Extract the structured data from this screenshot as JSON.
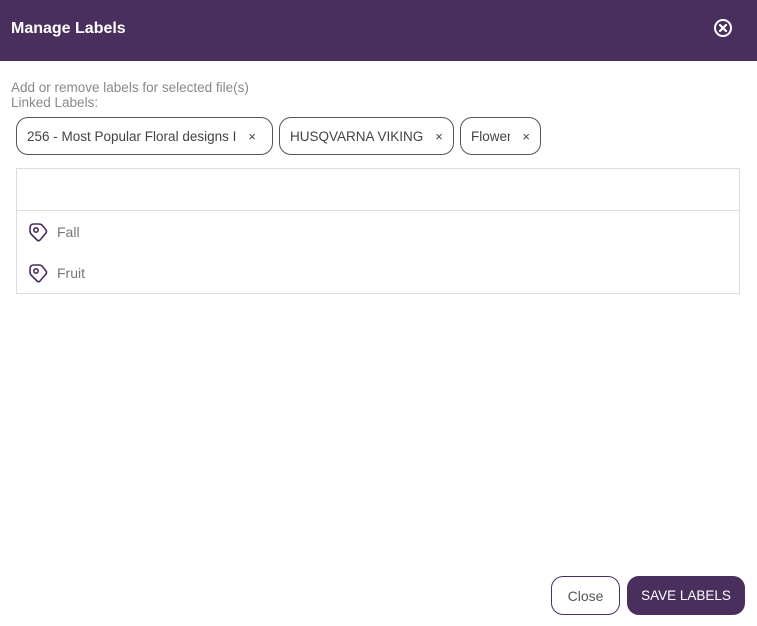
{
  "dialog": {
    "title": "Manage Labels",
    "close_icon": "close-circle-icon",
    "description": "Add or remove labels for selected file(s)",
    "linked_labels_caption": "Linked Labels:"
  },
  "linked_labels": [
    {
      "label": "256 - Most Popular Floral designs I",
      "remove": "×"
    },
    {
      "label": "HUSQVARNA VIKING",
      "remove": "×"
    },
    {
      "label": "Flower",
      "remove": "×"
    }
  ],
  "search": {
    "value": "",
    "placeholder": ""
  },
  "available_labels": [
    {
      "label": "Fall",
      "icon": "tag-icon"
    },
    {
      "label": "Fruit",
      "icon": "tag-icon"
    }
  ],
  "footer": {
    "close_label": "Close",
    "save_label": "SAVE LABELS"
  },
  "colors": {
    "brand": "#4a2f5e"
  }
}
